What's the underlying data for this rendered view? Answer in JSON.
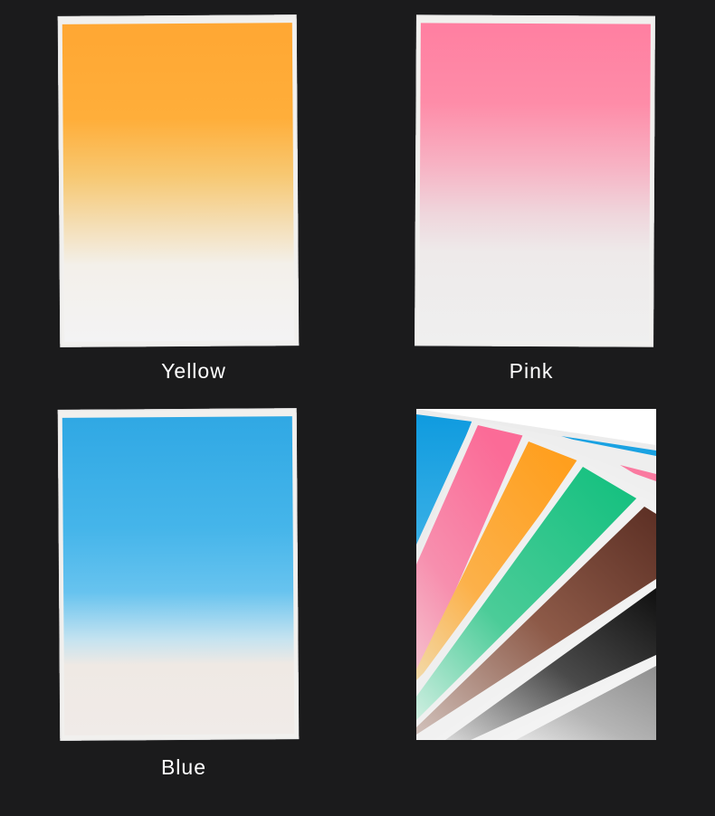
{
  "captions": {
    "yellow": "Yellow",
    "pink": "Pink",
    "blue": "Blue"
  },
  "colors": {
    "background": "#1b1b1c",
    "yellow_top": "#ffa733",
    "pink_top": "#ff7fa1",
    "blue_top": "#30a8e4",
    "fan_swatches": [
      "#139ddf",
      "#fb6f99",
      "#fea526",
      "#1fc484",
      "#6e3b2e",
      "#151515",
      "#9a9a9a"
    ]
  }
}
